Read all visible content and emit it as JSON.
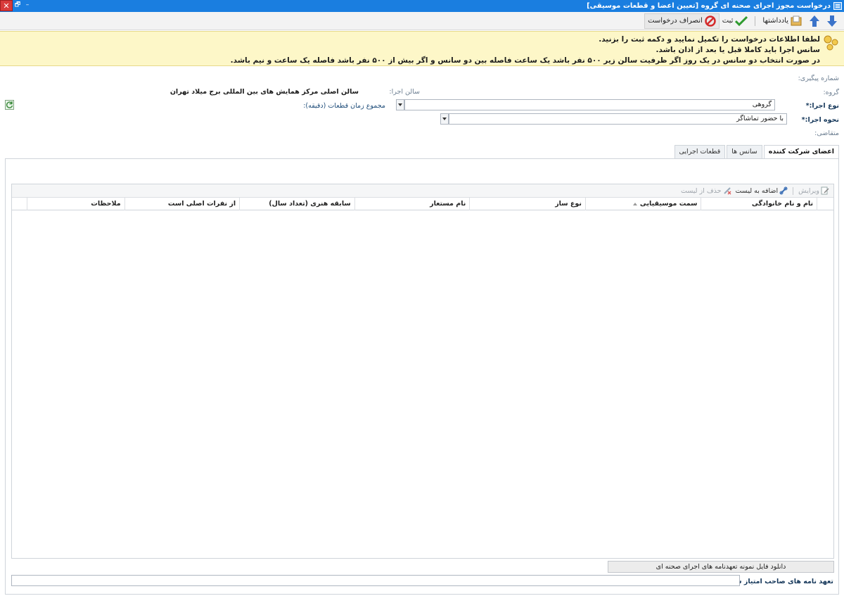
{
  "window": {
    "title": "درخواست مجوز اجرای صحنه ای گروه [تعیین اعضا و قطعات موسیقی]"
  },
  "toolbar": {
    "notes_label": "یادداشتها",
    "submit_label": "ثبت",
    "cancel_label": "انصراف درخواست"
  },
  "notice": {
    "lines": [
      "لطفا اطلاعات درخواست را تکمیل نمایید و دکمه ثبت را بزنید.",
      "سانس اجرا باید کاملا قبل یا بعد از اذان باشد.",
      "در صورت انتخاب دو سانس در یک روز اگر ظرفیت سالن زیر ۵۰۰ نفر باشد یک ساعت فاصله بین دو سانس و اگر بیش از ۵۰۰ نفر باشد فاصله یک ساعت و نیم باشد."
    ]
  },
  "form": {
    "tracking_label": "شماره پیگیری:",
    "group_label": "گروه:",
    "hall_label": "سالن اجرا:",
    "hall_value": "سالن اصلی مرکز همایش های بین المللی برج میلاد تهران",
    "perf_type_label": "نوع اجرا:*",
    "perf_type_value": "گروهی",
    "total_time_label": "مجموع زمان قطعات (دقیقه):",
    "perf_mode_label": "نحوه اجرا:*",
    "perf_mode_value": "با حضور تماشاگر",
    "applicant_label": "متقاضی:"
  },
  "tabs": [
    {
      "label": "اعضای شرکت کننده",
      "active": true
    },
    {
      "label": "سانس ها",
      "active": false
    },
    {
      "label": "قطعات اجرایی",
      "active": false
    }
  ],
  "grid": {
    "toolbar": {
      "edit_label": "ویرایش",
      "add_label": "اضافه به لیست",
      "delete_label": "حذف از لیست"
    },
    "columns": [
      "نام و نام خانوادگی",
      "سمت موسیقیایی",
      "نوع ساز",
      "نام مستعار",
      "سابقه هنری (تعداد سال)",
      "از نفرات اصلی است",
      "ملاحظات"
    ]
  },
  "bottom": {
    "download_label": "دانلود فایل نمونه تعهدنامه های اجرای صحنه ای",
    "commitment_label": "تعهد نامه های صاحب امتیاز شامل دو فرم:*"
  },
  "colors": {
    "titlebar": "#1a7ee0",
    "notice_bg": "#fdf7c8",
    "label_blue": "#1f4d7a"
  }
}
